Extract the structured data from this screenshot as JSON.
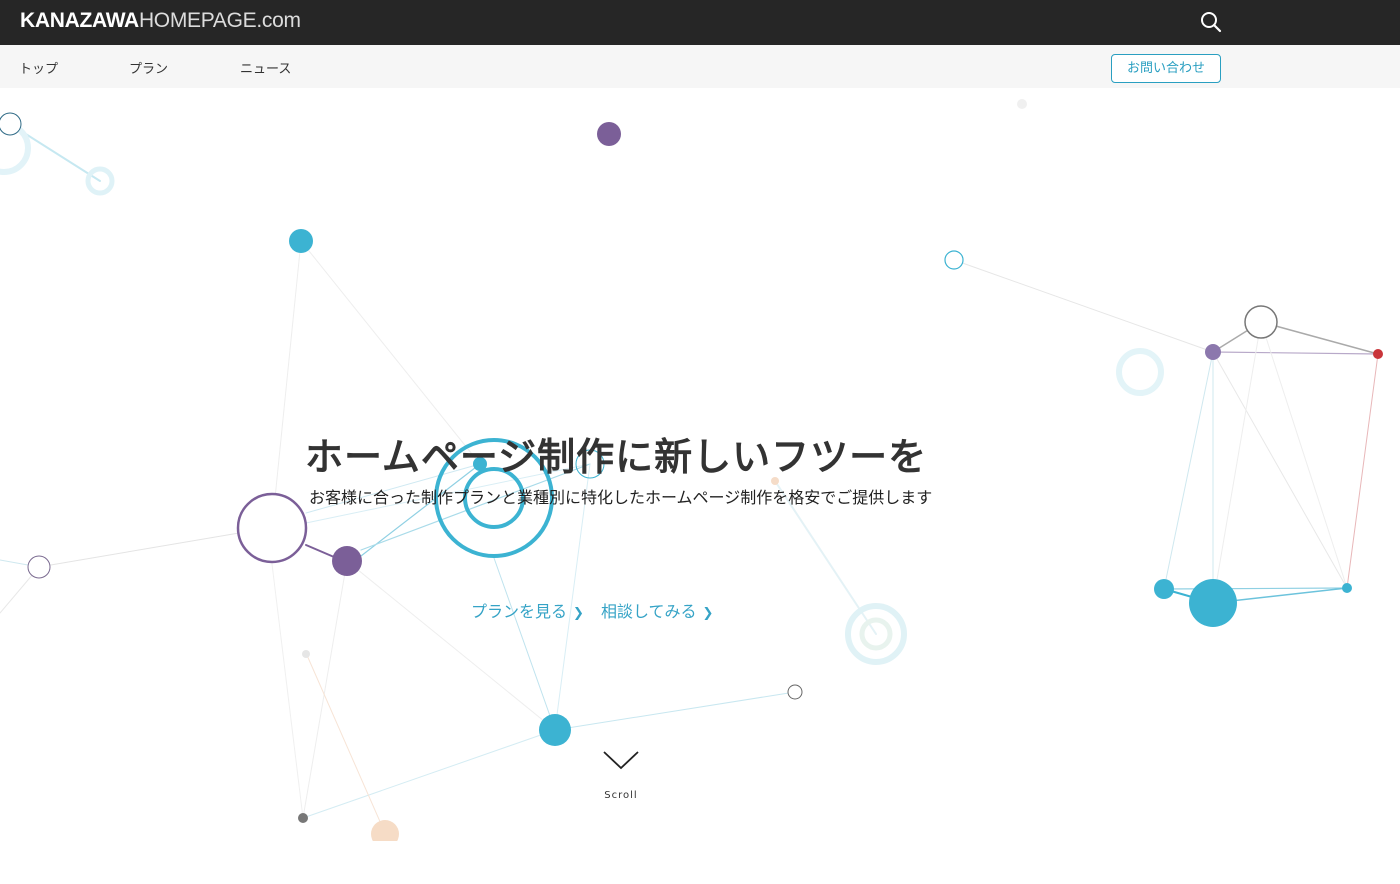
{
  "header": {
    "logo_bold": "KANAZAWA",
    "logo_thin": "HOMEPAGE.com",
    "search_icon": "search-icon"
  },
  "nav": {
    "items": [
      {
        "label": "トップ"
      },
      {
        "label": "プラン"
      },
      {
        "label": "ニュース"
      }
    ],
    "contact_label": "お問い合わせ"
  },
  "hero": {
    "headline": "ホームページ制作に新しいフツーを",
    "subline": "お客様に合った制作プランと業種別に特化したホームページ制作を格安でご提供します",
    "cta_plans": "プランを見る",
    "cta_consult": "相談してみる",
    "cta_icon": "chevron-right-icon",
    "scroll_label": "Scroll",
    "scroll_icon": "chevron-down-icon"
  },
  "colors": {
    "topbar": "#262626",
    "navbar": "#f6f6f6",
    "accent": "#35a3c6",
    "node_blue": "#3cb3d2",
    "node_purple": "#7b5f98",
    "node_red": "#c9353a",
    "node_orange": "#f2c9a7"
  }
}
